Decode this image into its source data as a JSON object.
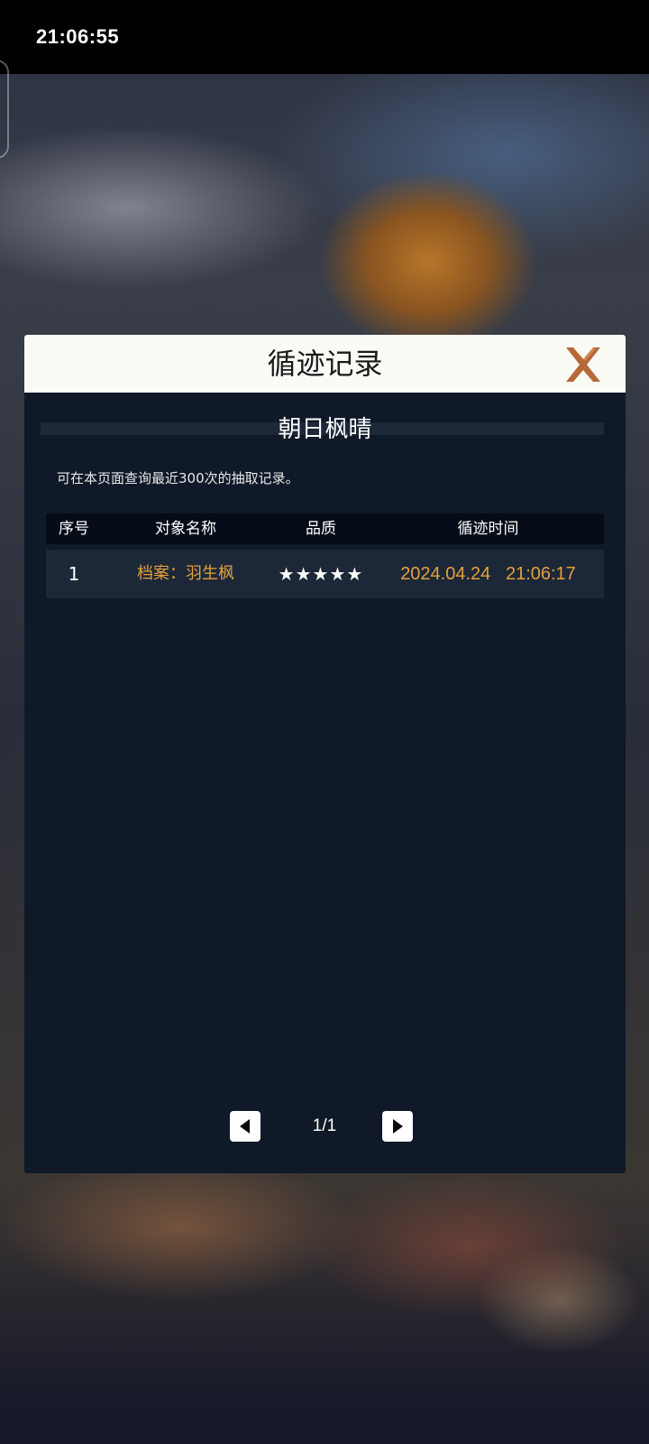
{
  "status_bar": {
    "time": "21:06:55"
  },
  "modal": {
    "title": "循迹记录",
    "subtitle": "朝日枫晴",
    "description": "可在本页面查询最近300次的抽取记录。",
    "close_icon": "close-x-icon",
    "accent_color": "#e6a03a",
    "close_color": "#b8693a"
  },
  "table": {
    "headers": [
      "序号",
      "对象名称",
      "品质",
      "循迹时间"
    ],
    "rows": [
      {
        "index": "1",
        "name": "档案：羽生枫",
        "quality_stars": 5,
        "quality": "★★★★★",
        "time": "2024.04.24   21:06:17"
      }
    ]
  },
  "pager": {
    "prev_icon": "prev-arrow-icon",
    "next_icon": "next-arrow-icon",
    "page": "1/1"
  }
}
